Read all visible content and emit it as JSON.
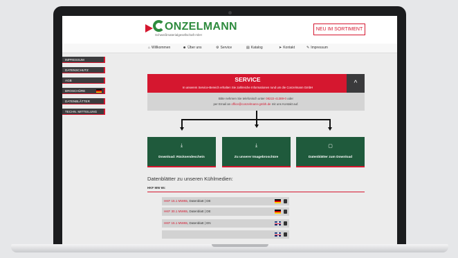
{
  "site": {
    "logo_name": "ONZELMANN",
    "logo_tagline": "Schweißmaterialgesellschaft mbH",
    "new_button": "NEU IM SORTIMENT"
  },
  "nav": {
    "items": [
      {
        "icon": "home-icon",
        "glyph": "⌂",
        "label": "Willkommen"
      },
      {
        "icon": "people-icon",
        "glyph": "☻",
        "label": "Über uns"
      },
      {
        "icon": "gear-icon",
        "glyph": "⚙",
        "label": "Service"
      },
      {
        "icon": "book-icon",
        "glyph": "▤",
        "label": "Katalog"
      },
      {
        "icon": "send-icon",
        "glyph": "➤",
        "label": "Kontakt"
      },
      {
        "icon": "wrench-icon",
        "glyph": "✎",
        "label": "Impressum"
      }
    ]
  },
  "sidebar": {
    "items": [
      {
        "label": "IMPRESSUM"
      },
      {
        "label": "DATENSCHUTZ"
      },
      {
        "label": "AGB"
      },
      {
        "label": "BROSCHÜRE",
        "flag": "de"
      },
      {
        "label": "DATENBLÄTTER"
      },
      {
        "label": "TECHN. MITTEILUNG"
      }
    ]
  },
  "service": {
    "title": "SERVICE",
    "subtitle": "In unserem Service-Bereich erhalten Sie zahlreiche Informationen rund um die Conzelmann GmbH",
    "up_glyph": "^",
    "contact_line1_prefix": "Bitte nehmen Sie telefonisch unter",
    "phone": "08222-41389-0",
    "contact_line1_suffix": "oder",
    "contact_line2_prefix": "per Email an",
    "email": "office@conzelmann-gmbh.de",
    "contact_line2_suffix": "mit uns Kontakt auf."
  },
  "downloads": [
    {
      "icon": "download-icon",
      "glyph": "⤓",
      "label": "Download: Rücksendeschein"
    },
    {
      "icon": "download-icon",
      "glyph": "⤓",
      "label": "Zu unserer Imagebroschüre"
    },
    {
      "icon": "document-icon",
      "glyph": "▢",
      "label": "Datenblätter zum Download"
    }
  ],
  "datasheets": {
    "heading": "Datenblätter zu unseren Kühlmedien:",
    "subheading": "HKF MW 65:",
    "rows": [
      {
        "model": "HKF 15.1 MW65",
        "text": ", Datenblatt | DE",
        "flag": "de"
      },
      {
        "model": "HKF 30.1 MW65",
        "text": ", Datenblatt | DE",
        "flag": "de"
      },
      {
        "model": "HKF 15.1 MW65",
        "text": ", Datenblatt | EN",
        "flag": "en"
      },
      {
        "model": "",
        "text": "",
        "flag": "en"
      }
    ]
  },
  "colors": {
    "brand_red": "#d5172f",
    "brand_green": "#2e8b3e",
    "button_green": "#1f5a3c"
  }
}
